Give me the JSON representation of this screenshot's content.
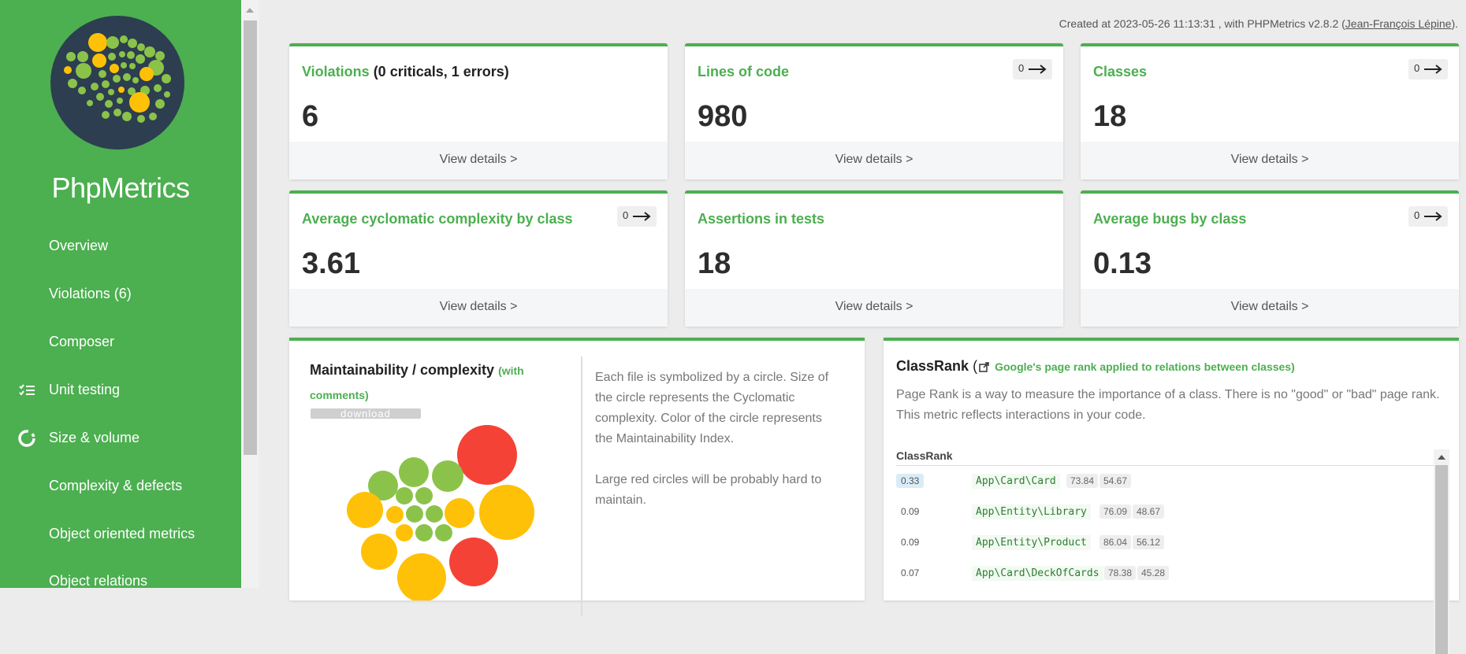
{
  "app": {
    "brand": "PhpMetrics",
    "created": {
      "prefix": "Created at 2023-05-26 11:13:31 , with PHPMetrics v2.8.2 (",
      "author": "Jean-François Lépine",
      "suffix": ")."
    }
  },
  "sidebar": {
    "items": [
      {
        "label": "Overview",
        "icon": ""
      },
      {
        "label": "Violations (6)",
        "icon": ""
      },
      {
        "label": "Composer",
        "icon": ""
      },
      {
        "label": "Unit testing",
        "icon": "checklist-icon"
      },
      {
        "label": "Size & volume",
        "icon": "donut-chart-icon"
      },
      {
        "label": "Complexity & defects",
        "icon": ""
      },
      {
        "label": "Object oriented metrics",
        "icon": ""
      },
      {
        "label": "Object relations",
        "icon": ""
      }
    ]
  },
  "cards": [
    {
      "title": "Violations",
      "title_extra": " (0 criticals, 1 errors)",
      "value": "6",
      "footer": "View details >",
      "trend": ""
    },
    {
      "title": "Lines of code",
      "title_extra": "",
      "value": "980",
      "footer": "View details >",
      "trend": "0"
    },
    {
      "title": "Classes",
      "title_extra": "",
      "value": "18",
      "footer": "View details >",
      "trend": "0"
    },
    {
      "title": "Average cyclomatic complexity by class",
      "title_extra": "",
      "value": "3.61",
      "footer": "View details >",
      "trend": "0"
    },
    {
      "title": "Assertions in tests",
      "title_extra": "",
      "value": "18",
      "footer": "View details >",
      "trend": ""
    },
    {
      "title": "Average bugs by class",
      "title_extra": "",
      "value": "0.13",
      "footer": "View details >",
      "trend": "0"
    }
  ],
  "maintainability": {
    "title": "Maintainability / complexity",
    "with_comments": "(with comments)",
    "download": "download",
    "desc1": "Each file is symbolized by a circle. Size of the circle represents the Cyclomatic complexity. Color of the circle represents the Maintainability Index.",
    "desc2": "Large red circles will be probably hard to maintain.",
    "colors": {
      "red": "#f44336",
      "orange": "#ffc107",
      "green": "#8bc34a"
    }
  },
  "classrank": {
    "title": "ClassRank",
    "link": "Google's page rank applied to relations between classes",
    "desc": "Page Rank is a way to measure the importance of a class. There is no \"good\" or \"bad\" page rank. This metric reflects interactions in your code.",
    "column": "ClassRank",
    "rows": [
      {
        "rank": "0.33",
        "class": "App\\Card\\Card",
        "m1": "73.84",
        "m2": "54.67"
      },
      {
        "rank": "0.09",
        "class": "App\\Entity\\Library",
        "m1": "76.09",
        "m2": "48.67"
      },
      {
        "rank": "0.09",
        "class": "App\\Entity\\Product",
        "m1": "86.04",
        "m2": "56.12"
      },
      {
        "rank": "0.07",
        "class": "App\\Card\\DeckOfCards",
        "m1": "78.38",
        "m2": "45.28"
      }
    ]
  },
  "colors": {
    "accent": "#4caf50",
    "background": "#ececec"
  }
}
